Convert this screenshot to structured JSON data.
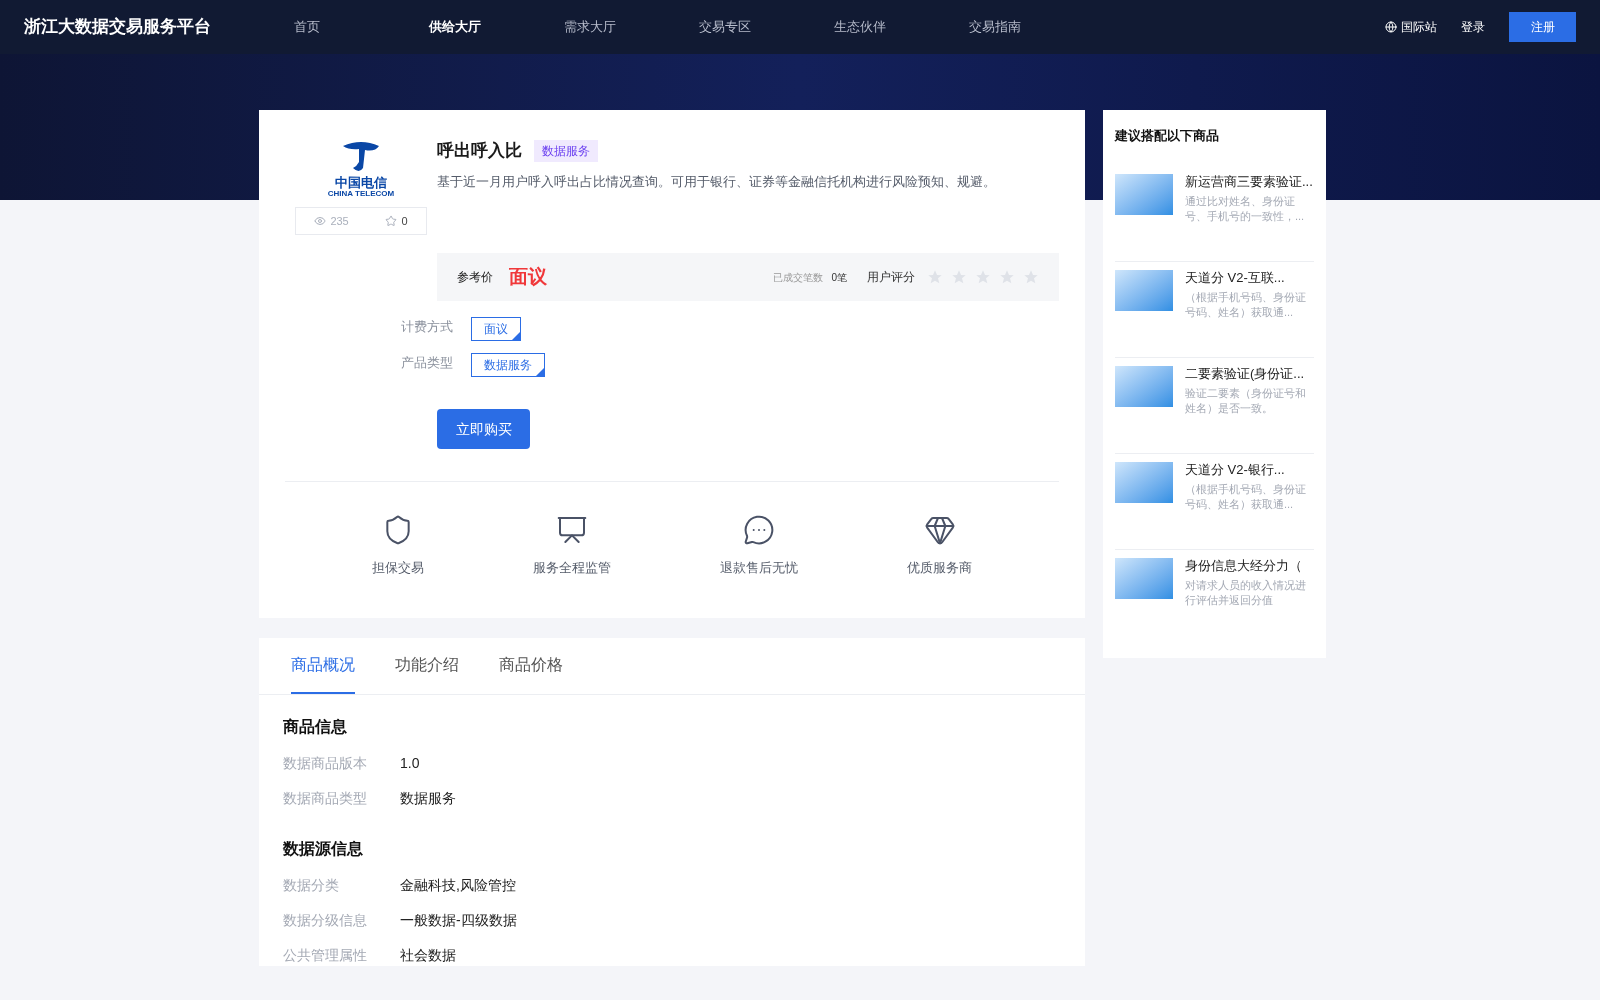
{
  "header": {
    "brand": "浙江大数据交易服务平台",
    "nav": [
      {
        "label": "首页",
        "selected": false
      },
      {
        "label": "供给大厅",
        "selected": true
      },
      {
        "label": "需求大厅",
        "selected": false
      },
      {
        "label": "交易专区",
        "selected": false
      },
      {
        "label": "生态伙伴",
        "selected": false
      },
      {
        "label": "交易指南",
        "selected": false
      }
    ],
    "intl": "国际站",
    "login": "登录",
    "register": "注册"
  },
  "product": {
    "logo": {
      "cn": "中国电信",
      "en": "CHINA TELECOM"
    },
    "views": "235",
    "favorites": "0",
    "title": "呼出呼入比",
    "tag": "数据服务",
    "description": "基于近一月用户呼入呼出占比情况查询。可用于银行、证券等金融信托机构进行风险预知、规避。",
    "price_label": "参考价",
    "price": "面议",
    "deals_label": "已成交笔数",
    "deals": "0笔",
    "rating_label": "用户评分",
    "stars": 0,
    "options": [
      {
        "label": "计费方式",
        "values": [
          {
            "text": "面议",
            "selected": true
          }
        ]
      },
      {
        "label": "产品类型",
        "values": [
          {
            "text": "数据服务",
            "selected": true
          }
        ]
      }
    ],
    "buy": "立即购买",
    "guarantees": [
      {
        "kind": "shield",
        "label": "担保交易"
      },
      {
        "kind": "monitor",
        "label": "服务全程监管"
      },
      {
        "kind": "chat",
        "label": "退款售后无忧"
      },
      {
        "kind": "diamond",
        "label": "优质服务商"
      }
    ]
  },
  "tabs": [
    {
      "label": "商品概况",
      "selected": true
    },
    {
      "label": "功能介绍",
      "selected": false
    },
    {
      "label": "商品价格",
      "selected": false
    }
  ],
  "sections": [
    {
      "title": "商品信息",
      "rows": [
        {
          "label": "数据商品版本",
          "value": "1.0"
        },
        {
          "label": "数据商品类型",
          "value": "数据服务"
        }
      ]
    },
    {
      "title": "数据源信息",
      "rows": [
        {
          "label": "数据分类",
          "value": "金融科技,风险管控"
        },
        {
          "label": "数据分级信息",
          "value": "一般数据-四级数据"
        },
        {
          "label": "公共管理属性",
          "value": "社会数据"
        }
      ]
    }
  ],
  "sidebar": {
    "title": "建议搭配以下商品",
    "items": [
      {
        "title": "新运营商三要素验证...",
        "description": "通过比对姓名、身份证号、手机号的一致性，..."
      },
      {
        "title": "天道分 V2-互联...",
        "description": "（根据手机号码、身份证号码、姓名）获取通..."
      },
      {
        "title": "二要素验证(身份证...",
        "description": "验证二要素（身份证号和姓名）是否一致。"
      },
      {
        "title": "天道分 V2-银行...",
        "description": "（根据手机号码、身份证号码、姓名）获取通..."
      },
      {
        "title": "身份信息大经分力（",
        "description": "对请求人员的收入情况进行评估并返回分值"
      }
    ]
  }
}
